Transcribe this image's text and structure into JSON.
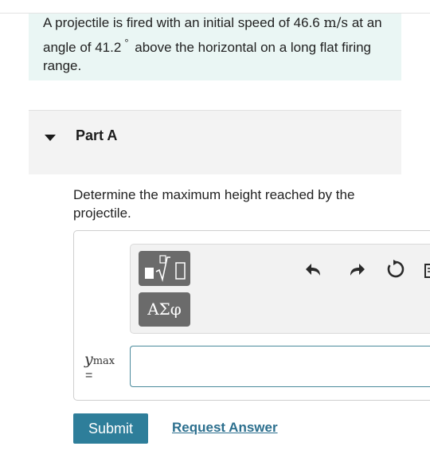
{
  "problem": {
    "text_1": "A projectile is fired with an initial speed of 46.6",
    "speed_unit": "m/s",
    "text_2": "at an angle of 41.2",
    "degree_symbol": "°",
    "text_3": "above the horizontal on a long flat firing range."
  },
  "part": {
    "title": "Part A"
  },
  "question": {
    "text": "Determine the maximum height reached by the projectile."
  },
  "toolbar": {
    "template_button_icon": "fraction-root-template-icon",
    "symbols_button_label": "ΑΣφ",
    "undo_icon": "undo-icon",
    "redo_icon": "redo-icon",
    "reset_icon": "reset-icon",
    "keyboard_icon": "keyboard-icon"
  },
  "answer": {
    "variable": "y",
    "subscript": "max",
    "equals": "=",
    "value": ""
  },
  "actions": {
    "submit_label": "Submit",
    "request_answer_label": "Request Answer"
  },
  "colors": {
    "problem_bg": "#eaf6f4",
    "accent": "#2e7e9a",
    "link": "#2c6f8e",
    "input_border": "#4a8a9c",
    "tool_button": "#6b6b6b"
  }
}
